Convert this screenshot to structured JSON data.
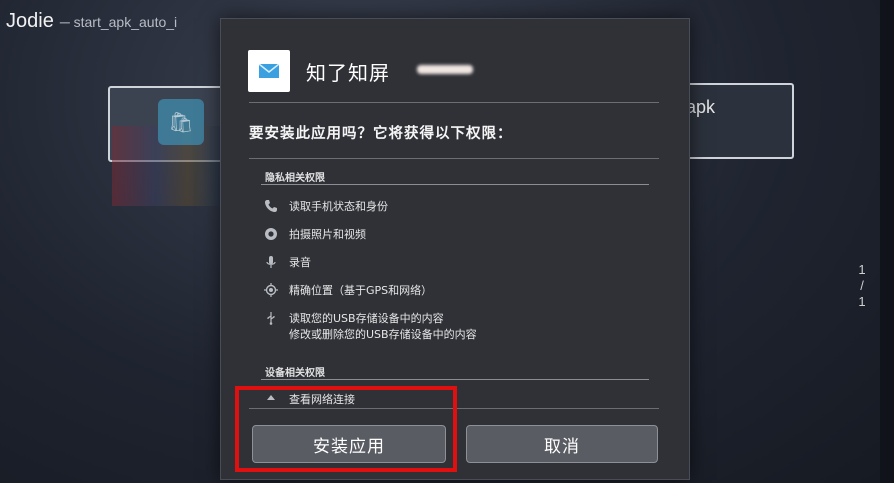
{
  "background": {
    "window_title": "Jodie",
    "window_subtitle": "─ start_apk_auto_i",
    "right_card_label": "apk",
    "page_indicator": [
      "1",
      "/",
      "1"
    ]
  },
  "dialog": {
    "app_name": "知了知屏",
    "question": "要安装此应用吗？它将获得以下权限：",
    "sections": [
      {
        "title": "隐私相关权限",
        "permissions": [
          {
            "icon": "phone-icon",
            "text": "读取手机状态和身份"
          },
          {
            "icon": "camera-icon",
            "text": "拍摄照片和视频"
          },
          {
            "icon": "microphone-icon",
            "text": "录音"
          },
          {
            "icon": "location-icon",
            "text": "精确位置（基于GPS和网络）"
          },
          {
            "icon": "usb-icon",
            "text": "读取您的USB存储设备中的内容",
            "text2": "修改或删除您的USB存储设备中的内容"
          }
        ]
      },
      {
        "title": "设备相关权限",
        "permissions": [
          {
            "icon": "network-icon",
            "text": "查看网络连接"
          }
        ]
      }
    ],
    "install_label": "安装应用",
    "cancel_label": "取消"
  },
  "colors": {
    "dialog_bg": "#2f3137",
    "button_bg": "#595c63",
    "highlight": "#e01010"
  }
}
